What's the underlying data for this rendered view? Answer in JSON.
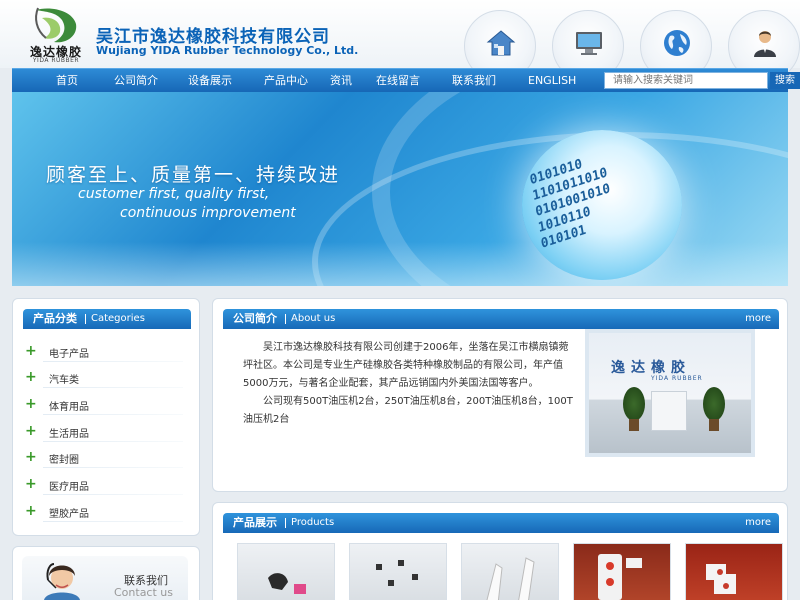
{
  "header": {
    "logo_text": "逸达橡胶",
    "logo_sub": "YIDA RUBBER",
    "company_cn": "吴江市逸达橡胶科技有限公司",
    "company_en": "Wujiang YIDA Rubber Technology Co., Ltd.",
    "quick_icons": [
      "home-icon",
      "computer-icon",
      "globe-icon",
      "user-icon"
    ]
  },
  "nav": {
    "items": [
      "首页",
      "公司简介",
      "设备展示",
      "产品中心",
      "资讯",
      "在线留言",
      "联系我们",
      "ENGLISH"
    ],
    "search_placeholder": "请输入搜索关键词",
    "search_button": "搜索"
  },
  "banner": {
    "slogan_cn": "顾客至上、质量第一、持续改进",
    "slogan_en_line1": "customer first, quality first,",
    "slogan_en_line2": "continuous improvement",
    "binary": "0101010\n1101011010\n0101001010\n1010110\n010101"
  },
  "categories": {
    "title_cn": "产品分类",
    "title_en": "Categories",
    "items": [
      "电子产品",
      "汽车类",
      "体育用品",
      "生活用品",
      "密封圈",
      "医疗用品",
      "塑胶产品"
    ]
  },
  "about": {
    "title_cn": "公司简介",
    "title_en": "About us",
    "more": "more",
    "paragraph1": "吴江市逸达橡胶科技有限公司创建于2006年，坐落在吴江市横扇镇菀坪社区。本公司是专业生产硅橡胶各类特种橡胶制品的有限公司，年产值5000万元，与著名企业配套，其产品远销国内外美国法国等客户。",
    "paragraph2": "公司现有500T油压机2台，250T油压机8台，200T油压机8台，100T油压机2台",
    "photo_sign": "逸达橡胶",
    "photo_sign_en": "YIDA RUBBER"
  },
  "products": {
    "title_cn": "产品展示",
    "title_en": "Products",
    "more": "more"
  },
  "contact": {
    "title_cn": "联系我们",
    "title_en": "Contact us"
  },
  "colors": {
    "primary": "#1767b6",
    "accent": "#2e8bd6",
    "bullet": "#3a9a2a"
  }
}
